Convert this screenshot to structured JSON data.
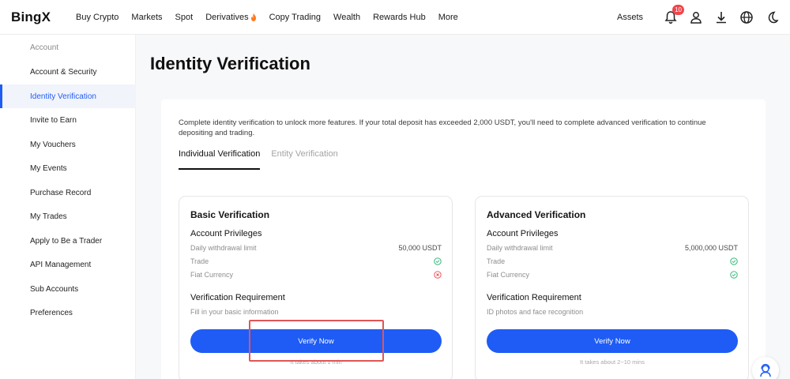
{
  "brand": {
    "logo": "BingX",
    "accent": "#1f5cf5"
  },
  "nav": {
    "items": [
      "Buy Crypto",
      "Markets",
      "Spot",
      "Derivatives",
      "Copy Trading",
      "Wealth",
      "Rewards Hub",
      "More"
    ],
    "assets": "Assets",
    "notifications_count": "10",
    "icons": [
      "bell-icon",
      "user-icon",
      "download-icon",
      "globe-icon",
      "moon-icon"
    ]
  },
  "sidebar": {
    "heading": "Account",
    "items": [
      "Account & Security",
      "Identity Verification",
      "Invite to Earn",
      "My Vouchers",
      "My Events",
      "Purchase Record",
      "My Trades",
      "Apply to Be a Trader",
      "API Management",
      "Sub Accounts",
      "Preferences"
    ],
    "active_index": 1
  },
  "page": {
    "title": "Identity Verification",
    "intro": "Complete identity verification to unlock more features. If your total deposit has exceeded 2,000 USDT, you'll need to complete advanced verification to continue depositing and trading.",
    "tabs": [
      "Individual Verification",
      "Entity Verification"
    ],
    "active_tab": 0
  },
  "cards": {
    "basic": {
      "title": "Basic Verification",
      "privileges_title": "Account Privileges",
      "rows": [
        {
          "label": "Daily withdrawal limit",
          "value": "50,000 USDT"
        },
        {
          "label": "Trade",
          "status": "check"
        },
        {
          "label": "Fiat Currency",
          "status": "cross"
        }
      ],
      "requirement_title": "Verification Requirement",
      "requirement_desc": "Fill in your basic information",
      "button": "Verify Now",
      "note": "It takes about 1 min"
    },
    "advanced": {
      "title": "Advanced Verification",
      "privileges_title": "Account Privileges",
      "rows": [
        {
          "label": "Daily withdrawal limit",
          "value": "5,000,000 USDT"
        },
        {
          "label": "Trade",
          "status": "check"
        },
        {
          "label": "Fiat Currency",
          "status": "check"
        }
      ],
      "requirement_title": "Verification Requirement",
      "requirement_desc": "ID photos and face recognition",
      "button": "Verify Now",
      "note": "It takes about 2~10 mins"
    }
  },
  "colors": {
    "check": "#20b26c",
    "cross": "#f0454b",
    "highlight": "#e05656"
  }
}
